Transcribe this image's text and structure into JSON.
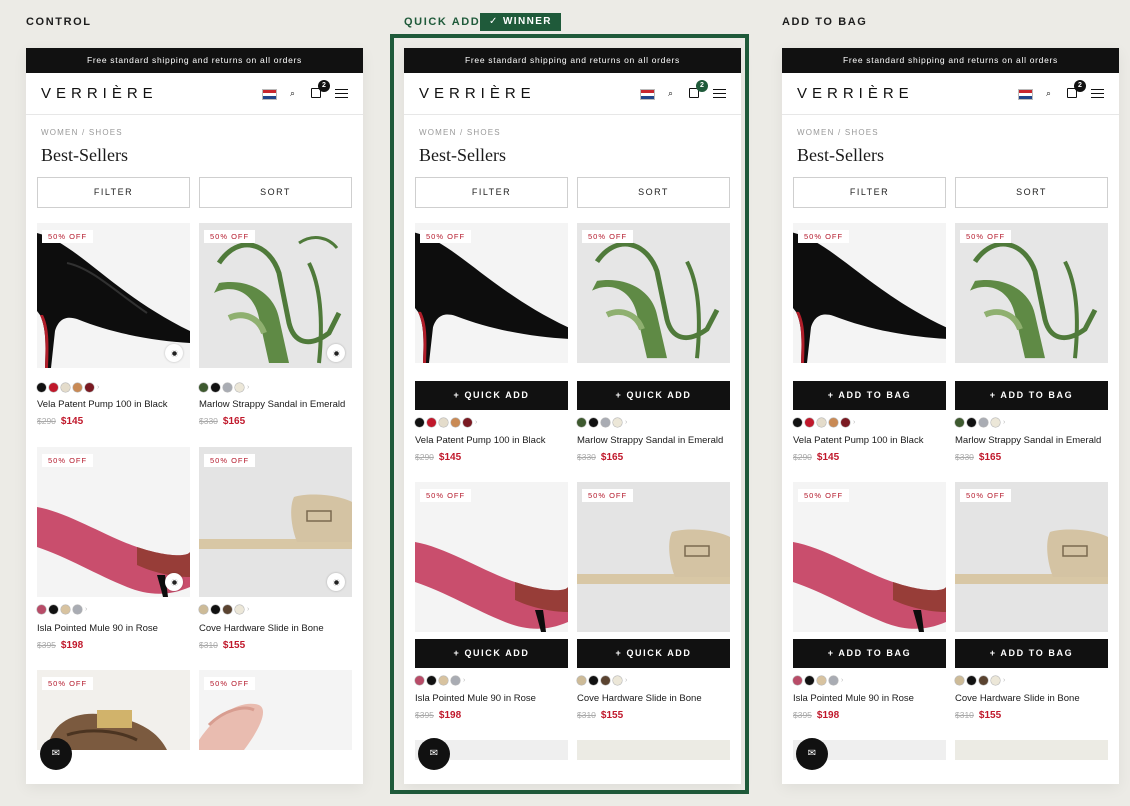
{
  "variants": [
    {
      "label": "CONTROL"
    },
    {
      "label": "QUICK ADD",
      "badge": "✓ WINNER",
      "action_label": "+ QUICK ADD"
    },
    {
      "label": "ADD TO BAG",
      "action_label": "+ ADD TO BAG"
    }
  ],
  "store": {
    "promo": "Free standard shipping and returns on all orders",
    "brand": "VERRIÈRE",
    "cart_count": "2",
    "breadcrumb": "WOMEN / SHOES",
    "title": "Best-Sellers",
    "filter_label": "FILTER",
    "sort_label": "SORT",
    "sale_badge": "50% OFF",
    "chat_icon": "✉",
    "search_glyph": "⌕"
  },
  "products": [
    {
      "name": "Vela Patent Pump 100 in Black",
      "old_price": "$290",
      "price": "$145",
      "swatches": [
        "#111111",
        "#c0182b",
        "#e4dccb",
        "#c98a55",
        "#7a1a22"
      ],
      "more": "›"
    },
    {
      "name": "Marlow Strappy Sandal in Emerald",
      "old_price": "$330",
      "price": "$165",
      "swatches": [
        "#3e5a2f",
        "#111111",
        "#a9acb3",
        "#ece7d8"
      ],
      "more": "›"
    },
    {
      "name": "Isla Pointed Mule 90 in Rose",
      "old_price": "$395",
      "price": "$198",
      "swatches": [
        "#b84c68",
        "#111111",
        "#d8c3a0",
        "#a9acb3"
      ],
      "more": "›"
    },
    {
      "name": "Cove Hardware Slide in Bone",
      "old_price": "$310",
      "price": "$155",
      "swatches": [
        "#cdbb98",
        "#111111",
        "#5a4330",
        "#ece7d8"
      ],
      "more": "›"
    }
  ]
}
